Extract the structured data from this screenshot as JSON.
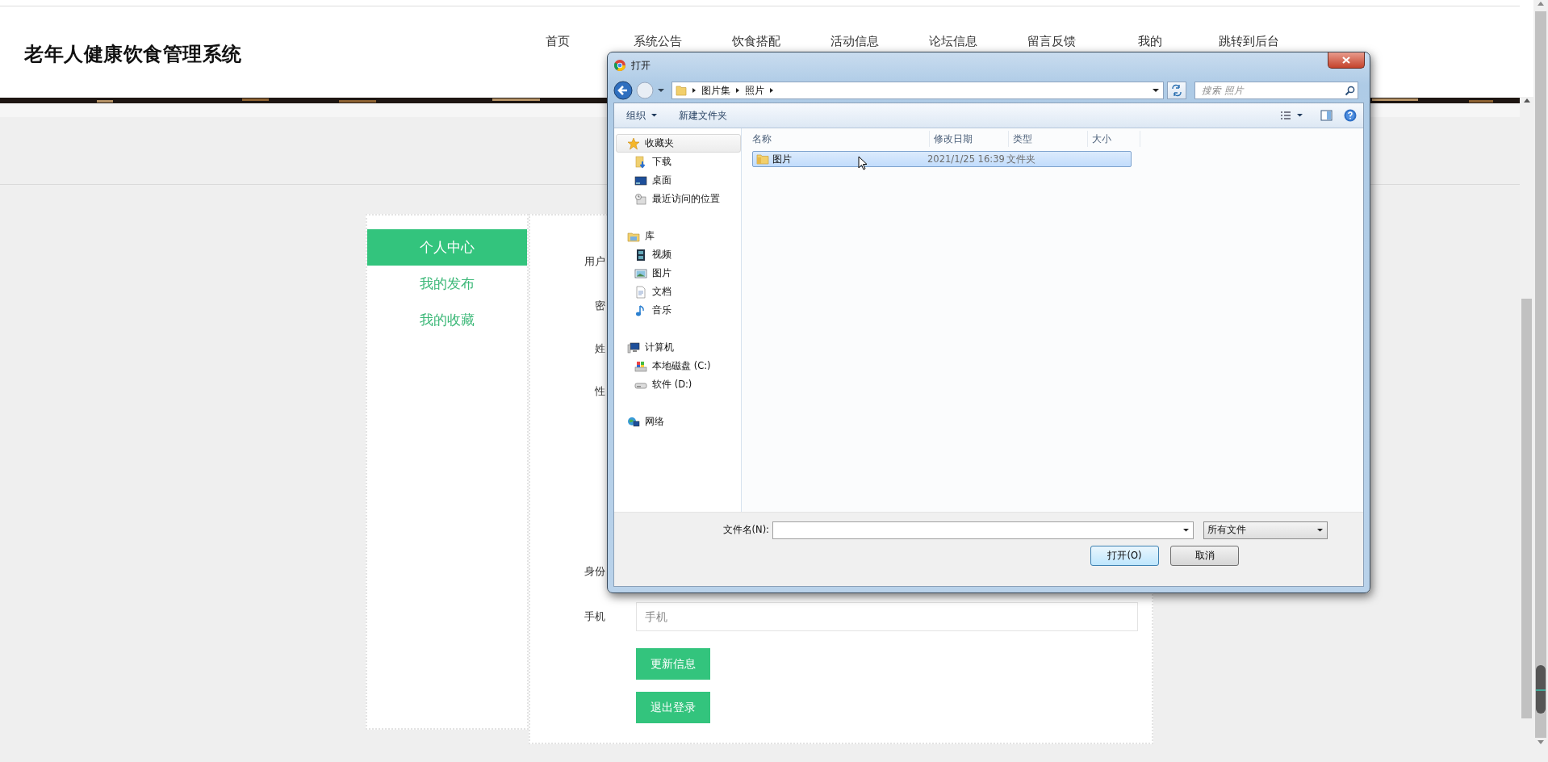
{
  "header": {
    "title": "老年人健康饮食管理系统",
    "nav": [
      {
        "label": "首页"
      },
      {
        "label": "系统公告"
      },
      {
        "label": "饮食搭配"
      },
      {
        "label": "活动信息"
      },
      {
        "label": "论坛信息"
      },
      {
        "label": "留言反馈"
      },
      {
        "label": "我的"
      },
      {
        "label": "跳转到后台"
      }
    ]
  },
  "sidebar": {
    "items": [
      {
        "label": "个人中心",
        "selected": true
      },
      {
        "label": "我的发布",
        "selected": false
      },
      {
        "label": "我的收藏",
        "selected": false
      }
    ]
  },
  "form": {
    "fields": [
      {
        "label": "用户"
      },
      {
        "label": "密"
      },
      {
        "label": "姓"
      },
      {
        "label": "性"
      },
      {
        "label": "身份"
      },
      {
        "label": "手机",
        "placeholder": "手机"
      }
    ],
    "buttons": [
      "更新信息",
      "退出登录"
    ]
  },
  "dialog": {
    "title": "打开",
    "path": [
      "图片集",
      "照片"
    ],
    "search": {
      "placeholder": "搜索 照片"
    },
    "toolbar": {
      "organize": "组织",
      "new_folder": "新建文件夹"
    },
    "nav_groups": [
      {
        "label": "收藏夹",
        "kind": "favorites",
        "selected": true,
        "children": [
          {
            "label": "下载",
            "kind": "download",
            "selected": false
          },
          {
            "label": "桌面",
            "kind": "desktop",
            "selected": false
          },
          {
            "label": "最近访问的位置",
            "kind": "recent",
            "selected": false
          }
        ]
      },
      {
        "label": "库",
        "kind": "library",
        "selected": false,
        "children": [
          {
            "label": "视频",
            "kind": "video",
            "selected": false
          },
          {
            "label": "图片",
            "kind": "pictures",
            "selected": false
          },
          {
            "label": "文档",
            "kind": "documents",
            "selected": false
          },
          {
            "label": "音乐",
            "kind": "music",
            "selected": false
          }
        ]
      },
      {
        "label": "计算机",
        "kind": "computer",
        "selected": false,
        "children": [
          {
            "label": "本地磁盘 (C:)",
            "kind": "system-disk",
            "selected": false
          },
          {
            "label": "软件 (D:)",
            "kind": "drive",
            "selected": false
          }
        ]
      },
      {
        "label": "网络",
        "kind": "network",
        "selected": false
      }
    ],
    "columns": [
      "名称",
      "修改日期",
      "类型",
      "大小"
    ],
    "rows": [
      {
        "name": "图片",
        "modified": "2021/1/25 16:39",
        "type": "文件夹",
        "selected": true
      }
    ],
    "filename_label": "文件名(N):",
    "filter": "所有文件",
    "open_button": "打开(O)",
    "cancel_button": "取消"
  }
}
